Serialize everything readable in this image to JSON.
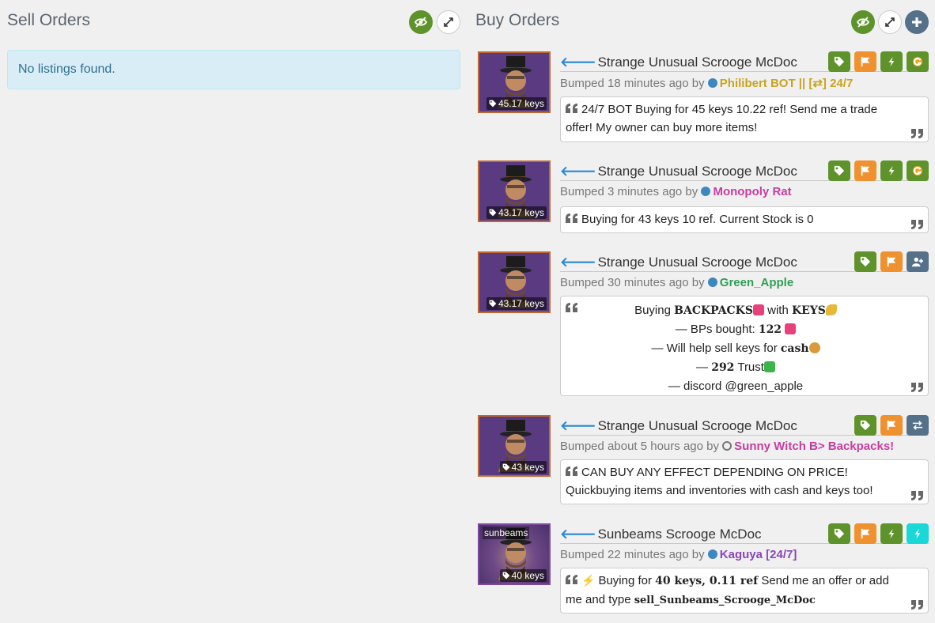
{
  "sell": {
    "title": "Sell Orders",
    "empty_message": "No listings found."
  },
  "buy": {
    "title": "Buy Orders"
  },
  "listings": [
    {
      "price": "45.17 keys",
      "name": "Strange Unusual Scrooge McDoc",
      "bumped": "Bumped 18 minutes ago by",
      "user": "Philibert BOT || [⇄] 24/7",
      "user_color": "#c8a41e",
      "comment": "24/7 BOT Buying for 45 keys 10.22 ref! Send me a trade offer! My owner can buy more items!",
      "badges": [
        "price-tag-icon",
        "flag-icon",
        "bolt-icon",
        "g-logo-icon"
      ]
    },
    {
      "price": "43.17 keys",
      "name": "Strange Unusual Scrooge McDoc",
      "bumped": "Bumped 3 minutes ago by",
      "user": "Monopoly Rat",
      "user_color": "#c63da0",
      "comment": "Buying for 43 keys 10 ref. Current Stock is 0",
      "badges": [
        "price-tag-icon",
        "flag-icon",
        "bolt-icon",
        "g-logo-icon"
      ]
    },
    {
      "price": "43.17 keys",
      "name": "Strange Unusual Scrooge McDoc",
      "bumped": "Bumped 30 minutes ago by",
      "user": "Green_Apple",
      "user_color": "#2f9e55",
      "comment_lines": {
        "l1a": "Buying ",
        "l1b": "BACKPACKS",
        "l1c": " with ",
        "l1d": "KEYS",
        "l2a": "— BPs bought: ",
        "l2b": "122",
        "l3a": "— Will help sell keys for ",
        "l3b": "cash",
        "l4a": "— ",
        "l4b": "292",
        "l4c": " Trust",
        "l5": "— discord @green_apple"
      },
      "badges": [
        "price-tag-icon",
        "flag-icon",
        "add-friend-icon"
      ]
    },
    {
      "price": "43 keys",
      "name": "Strange Unusual Scrooge McDoc",
      "bumped": "Bumped about 5 hours ago by",
      "user": "Sunny Witch B> Backpacks!",
      "user_color": "#c63da0",
      "comment": "CAN BUY ANY EFFECT DEPENDING ON PRICE! Quickbuying items and inventories with cash and keys too!",
      "badges": [
        "price-tag-icon",
        "flag-icon",
        "exchange-icon"
      ]
    },
    {
      "price": "40 keys",
      "effect": "sunbeams",
      "name": "Sunbeams Scrooge McDoc",
      "bumped": "Bumped 22 minutes ago by",
      "user": "Kaguya [24/7]",
      "user_color": "#8a46b8",
      "comment_rich": {
        "a": "Buying for ",
        "b": "40 keys, 0.11 ref",
        "c": " Send me an offer or add me and type ",
        "d": "sell_Sunbeams_Scrooge_McDoc"
      },
      "badges": [
        "price-tag-icon",
        "flag-icon",
        "bolt-icon",
        "cyan-bolt-icon"
      ]
    }
  ]
}
